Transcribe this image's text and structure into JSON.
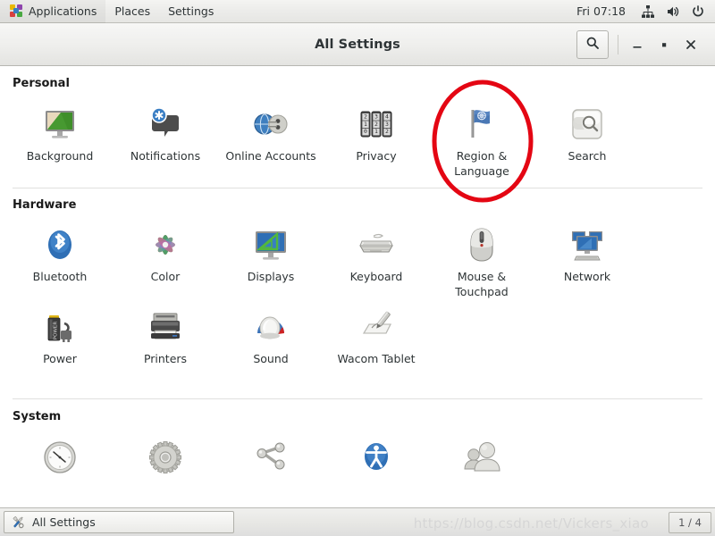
{
  "top_panel": {
    "app_menu_icon": "pinwheel-icon",
    "menus": [
      "Applications",
      "Places",
      "Settings"
    ],
    "clock": "Fri 07:18",
    "tray_icons": [
      "network-icon",
      "volume-icon",
      "power-icon"
    ]
  },
  "window": {
    "title": "All Settings",
    "search_icon": "search-icon",
    "minimize_label": "—",
    "maximize_label": "□",
    "close_label": "✕"
  },
  "sections": [
    {
      "title": "Personal",
      "items": [
        {
          "label": "Background",
          "icon": "background-icon"
        },
        {
          "label": "Notifications",
          "icon": "notifications-icon"
        },
        {
          "label": "Online Accounts",
          "icon": "online-accounts-icon"
        },
        {
          "label": "Privacy",
          "icon": "privacy-icon"
        },
        {
          "label": "Region & Language",
          "icon": "region-language-icon",
          "highlighted": true
        },
        {
          "label": "Search",
          "icon": "search-panel-icon"
        }
      ]
    },
    {
      "title": "Hardware",
      "items": [
        {
          "label": "Bluetooth",
          "icon": "bluetooth-icon"
        },
        {
          "label": "Color",
          "icon": "color-icon"
        },
        {
          "label": "Displays",
          "icon": "displays-icon"
        },
        {
          "label": "Keyboard",
          "icon": "keyboard-icon"
        },
        {
          "label": "Mouse & Touchpad",
          "icon": "mouse-touchpad-icon"
        },
        {
          "label": "Network",
          "icon": "network-panel-icon"
        },
        {
          "label": "Power",
          "icon": "power-panel-icon"
        },
        {
          "label": "Printers",
          "icon": "printers-icon"
        },
        {
          "label": "Sound",
          "icon": "sound-icon"
        },
        {
          "label": "Wacom Tablet",
          "icon": "wacom-tablet-icon"
        }
      ]
    },
    {
      "title": "System",
      "items": [
        {
          "label": "",
          "icon": "clock-icon"
        },
        {
          "label": "",
          "icon": "details-gear-icon"
        },
        {
          "label": "",
          "icon": "sharing-icon"
        },
        {
          "label": "",
          "icon": "universal-access-icon"
        },
        {
          "label": "",
          "icon": "users-icon"
        }
      ]
    }
  ],
  "taskbar": {
    "task_icon": "tools-icon",
    "task_label": "All Settings",
    "workspace_indicator": "1 / 4",
    "watermark": "https://blog.csdn.net/Vickers_xiao"
  },
  "annotation": {
    "type": "ellipse",
    "color": "#e40613",
    "target": "Region & Language"
  },
  "colors": {
    "panel_bg": "#ececea",
    "window_bg": "#ffffff",
    "text": "#2e3436",
    "divider": "#e0e0de",
    "annotation_red": "#e40613"
  }
}
